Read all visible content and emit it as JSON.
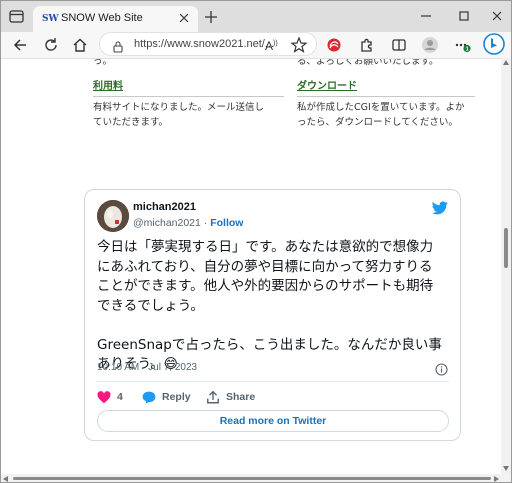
{
  "browser": {
    "tab_title": "SNOW Web Site",
    "favicon_text": "SW",
    "url": "https://www.snow2021.net/..."
  },
  "page": {
    "top_cutoff_left": "っ。",
    "top_cutoff_right": "る、よろしくお願いいたします。",
    "sections": [
      {
        "link": "利用料",
        "lines": [
          "有料サイトになりました。メール送信し",
          "ていただきます。"
        ]
      },
      {
        "link": "ダウンロード",
        "lines": [
          "私が作成したCGIを置いています。よか",
          "ったら、ダウンロードしてください。"
        ]
      }
    ]
  },
  "tweet": {
    "name": "michan2021",
    "handle": "@michan2021",
    "separator": " · ",
    "follow": "Follow",
    "body_lines_p1": [
      "今日は「夢実現する日」です。あなたは意欲的で想像力",
      "にあふれており、自分の夢や目標に向かって努力すりる",
      "ことができます。他人や外的要因からのサポートも期待",
      "できるでしょう。"
    ],
    "body_lines_p2": [
      "GreenSnapで占ったら、こう出ました。なんだか良い事",
      "ありそう。😄"
    ],
    "timestamp": "10:10 AM · Jul 7, 2023",
    "likes": "4",
    "reply": "Reply",
    "share": "Share",
    "read_more": "Read more on Twitter"
  },
  "colors": {
    "link_green": "#2d6b2d",
    "twitter_blue": "#1d9bf0",
    "like_pink": "#f91880"
  },
  "icons": [
    "tab-actions-icon",
    "close-icon",
    "plus-icon",
    "minimize-icon",
    "maximize-icon",
    "back-icon",
    "refresh-icon",
    "home-icon",
    "lock-icon",
    "read-aloud-icon",
    "favorite-star-icon",
    "extension-red-icon",
    "puzzle-icon",
    "split-screen-icon",
    "profile-icon",
    "menu-dots-icon",
    "bing-icon",
    "twitter-bird-icon",
    "info-icon",
    "heart-icon",
    "reply-bubble-icon",
    "share-icon"
  ]
}
